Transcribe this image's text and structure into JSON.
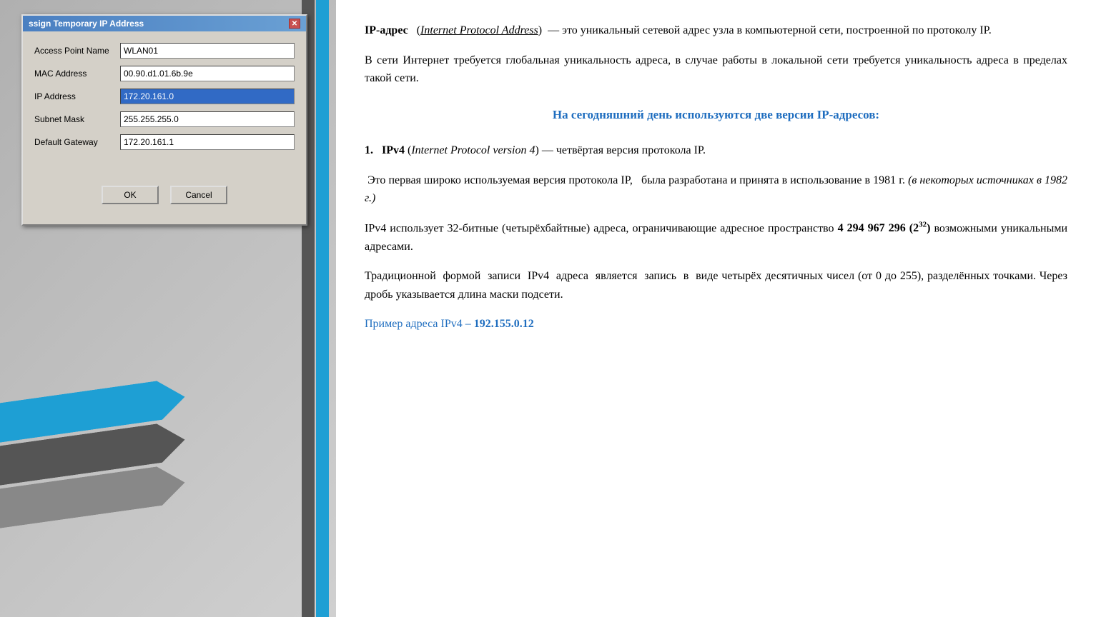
{
  "dialog": {
    "title": "ssign Temporary IP Address",
    "fields": [
      {
        "label": "Access Point Name",
        "value": "WLAN01",
        "selected": false,
        "id": "access-point-name"
      },
      {
        "label": "MAC Address",
        "value": "00.90.d1.01.6b.9e",
        "selected": false,
        "id": "mac-address"
      },
      {
        "label": "IP Address",
        "value": "172.20.161.0",
        "selected": true,
        "id": "ip-address"
      },
      {
        "label": "Subnet Mask",
        "value": "255.255.255.0",
        "selected": false,
        "id": "subnet-mask"
      },
      {
        "label": "Default Gateway",
        "value": "172.20.161.1",
        "selected": false,
        "id": "default-gateway"
      }
    ],
    "ok_label": "OK",
    "cancel_label": "Cancel"
  },
  "content": {
    "para1_bold": "IP-адрес",
    "para1_italic_underline": "Internet Protocol Address",
    "para1_rest": " — это уникальный сетевой адрес узла в компьютерной сети, построенной по протоколу IP.",
    "para2": "В сети Интернет требуется глобальная уникальность адреса, в случае работы в локальной сети требуется уникальность адреса в пределах такой сети.",
    "heading_blue": "На сегодняшний день используются две версии IP-адресов:",
    "ipv4_label": "IPv4",
    "ipv4_italic": "Internet Protocol version 4",
    "ipv4_desc": " — четвёртая версия протокола IP.",
    "ipv4_para1": "Это первая широко используемая версия протокола IP,  была разработана и принята в использование в 1981 г.",
    "ipv4_para1_italic": "(в некоторых источниках в 1982 г.)",
    "ipv4_para2_prefix": "IPv4 использует 32-битные (четырёхбайтные) адреса, ограничивающие адресное пространство ",
    "ipv4_para2_bold": "4 294 967 296 (2",
    "ipv4_para2_sup": "32",
    "ipv4_para2_suffix": ") возможными уникальными адресами.",
    "ipv4_para3": "Традиционной формой записи IPv4 адреса является запись в виде четырёх десятичных чисел (от 0 до 255), разделённых точками. Через дробь указывается длина маски подсети.",
    "example_prefix": "Пример адреса IPv4 – ",
    "example_bold": "192.155.0.12"
  }
}
